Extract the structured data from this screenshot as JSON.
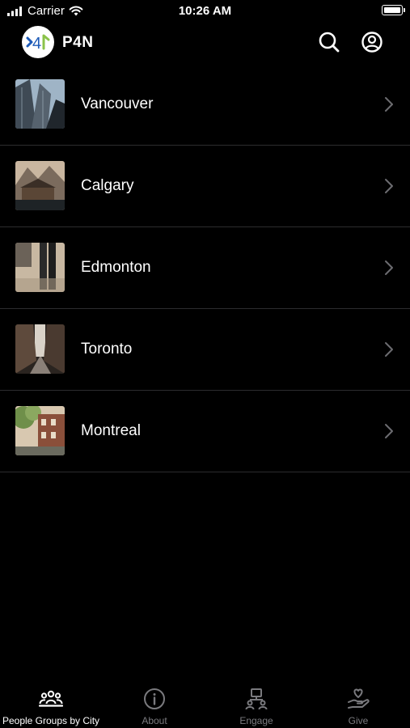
{
  "status_bar": {
    "carrier": "Carrier",
    "time": "10:26 AM",
    "icons": [
      "signal-icon",
      "wifi-icon",
      "battery-icon"
    ]
  },
  "header": {
    "app_title": "P4N",
    "logo_text": "4",
    "icons": [
      "search-icon",
      "account-icon"
    ]
  },
  "cities": [
    {
      "name": "Vancouver",
      "thumb_colors": [
        "#8aa3b8",
        "#3f4a55",
        "#20262c"
      ]
    },
    {
      "name": "Calgary",
      "thumb_colors": [
        "#c9b6a0",
        "#5a4636",
        "#1e2326"
      ]
    },
    {
      "name": "Edmonton",
      "thumb_colors": [
        "#c8b8a2",
        "#2a2a2a",
        "#8a7a68"
      ]
    },
    {
      "name": "Toronto",
      "thumb_colors": [
        "#d9d2c8",
        "#5e4a3c",
        "#2a2420"
      ]
    },
    {
      "name": "Montreal",
      "thumb_colors": [
        "#7f9a5a",
        "#8a4f3a",
        "#d8c8b0"
      ]
    }
  ],
  "tabs": [
    {
      "label": "People Groups by City",
      "icon": "people-groups-icon",
      "active": true
    },
    {
      "label": "About",
      "icon": "info-icon",
      "active": false
    },
    {
      "label": "Engage",
      "icon": "engage-icon",
      "active": false
    },
    {
      "label": "Give",
      "icon": "give-hand-heart-icon",
      "active": false
    }
  ],
  "colors": {
    "background": "#000000",
    "divider": "#2c2c2e",
    "inactive_tab": "#7a7a7e",
    "logo_blue": "#1e5bb8",
    "logo_green": "#8bc34a"
  }
}
